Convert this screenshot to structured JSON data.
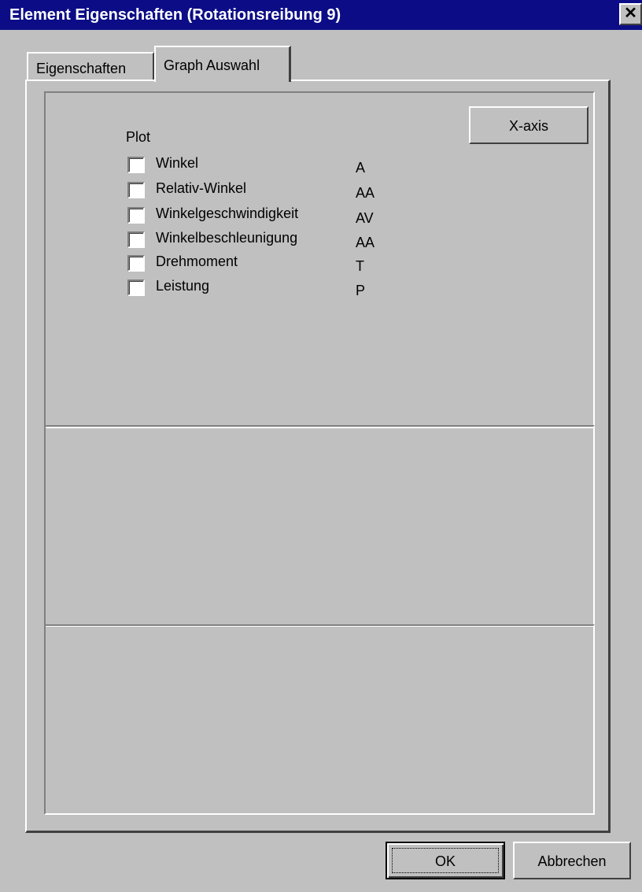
{
  "window": {
    "title": "Element Eigenschaften (Rotationsreibung 9)",
    "close_glyph": "✕"
  },
  "tabs": [
    {
      "label": "Eigenschaften",
      "active": false
    },
    {
      "label": "Graph Auswahl",
      "active": true
    }
  ],
  "plot": {
    "heading": "Plot",
    "items": [
      {
        "label": "Winkel",
        "abbr": "A",
        "checked": false
      },
      {
        "label": "Relativ-Winkel",
        "abbr": "AA",
        "checked": false
      },
      {
        "label": "Winkelgeschwindigkeit",
        "abbr": "AV",
        "checked": false
      },
      {
        "label": "Winkelbeschleunigung",
        "abbr": "AA",
        "checked": false
      },
      {
        "label": "Drehmoment",
        "abbr": "T",
        "checked": false
      },
      {
        "label": "Leistung",
        "abbr": "P",
        "checked": false
      }
    ]
  },
  "buttons": {
    "xaxis": "X-axis",
    "ok": "OK",
    "cancel": "Abbrechen"
  },
  "colors": {
    "titlebar": "#0c0d86",
    "face": "#c0c0c0"
  }
}
